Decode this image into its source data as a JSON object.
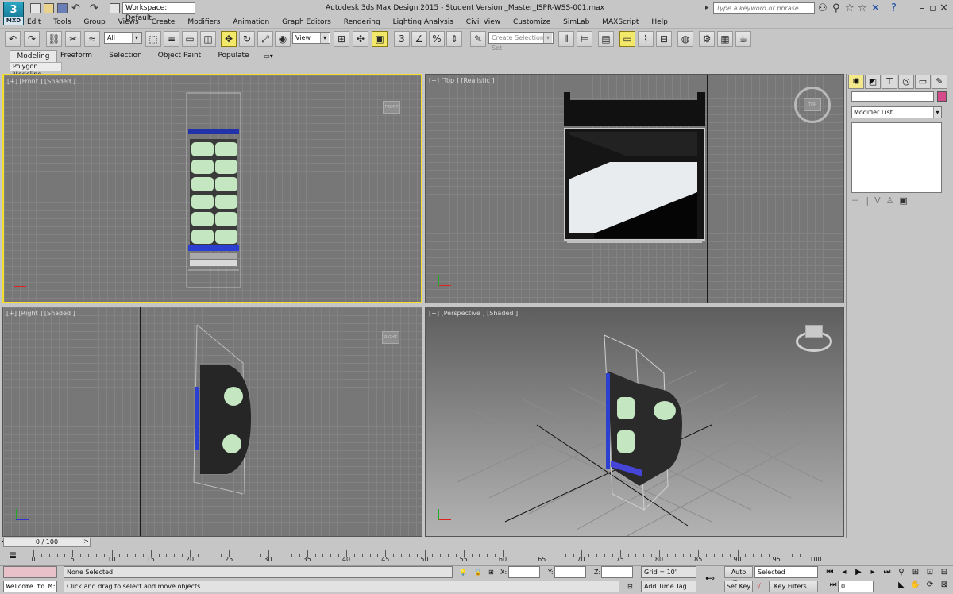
{
  "titlebar": {
    "logo": "3",
    "logo_sub": "MXD",
    "workspace": "Workspace: Default",
    "title": "Autodesk 3ds Max Design 2015  -  Student Version    _Master_ISPR-WSS-001.max",
    "search_placeholder": "Type a keyword or phrase"
  },
  "menu": [
    "Edit",
    "Tools",
    "Group",
    "Views",
    "Create",
    "Modifiers",
    "Animation",
    "Graph Editors",
    "Rendering",
    "Lighting Analysis",
    "Civil View",
    "Customize",
    "SimLab",
    "MAXScript",
    "Help"
  ],
  "toolbar": {
    "selection_filter": "All",
    "reference_coord": "View",
    "named_selection_placeholder": "Create Selection Set"
  },
  "ribbon": {
    "tabs": [
      "Modeling",
      "Freeform",
      "Selection",
      "Object Paint",
      "Populate"
    ],
    "active_tab": "Modeling",
    "sub_panel": "Polygon Modeling"
  },
  "viewports": {
    "front": {
      "label": "[+] [Front ] [Shaded ]",
      "cube": "FRONT"
    },
    "top": {
      "label": "[+] [Top ] [Realistic ]",
      "cube": "TOP"
    },
    "right": {
      "label": "[+] [Right ] [Shaded ]",
      "cube": "RIGHT"
    },
    "perspective": {
      "label": "[+] [Perspective ] [Shaded ]"
    }
  },
  "command_panel": {
    "modifier_list": "Modifier List"
  },
  "timeline": {
    "slider": "0 / 100",
    "ticks": [
      "0",
      "5",
      "10",
      "15",
      "20",
      "25",
      "30",
      "35",
      "40",
      "45",
      "50",
      "55",
      "60",
      "65",
      "70",
      "75",
      "80",
      "85",
      "90",
      "95",
      "100"
    ]
  },
  "status": {
    "selection": "None Selected",
    "prompt": "Click and drag to select and move objects",
    "listener": "Welcome to M:",
    "x_label": "X:",
    "y_label": "Y:",
    "z_label": "Z:",
    "grid": "Grid = 10\"",
    "add_time_tag": "Add Time Tag",
    "auto_key": "Auto Key",
    "set_key": "Set Key",
    "key_mode": "Selected",
    "key_filters": "Key Filters...",
    "frame": "0"
  },
  "colors": {
    "active_viewport_border": "#f2dd2c",
    "viewport_bg": "#777777",
    "object_color": "#d44a8a"
  }
}
